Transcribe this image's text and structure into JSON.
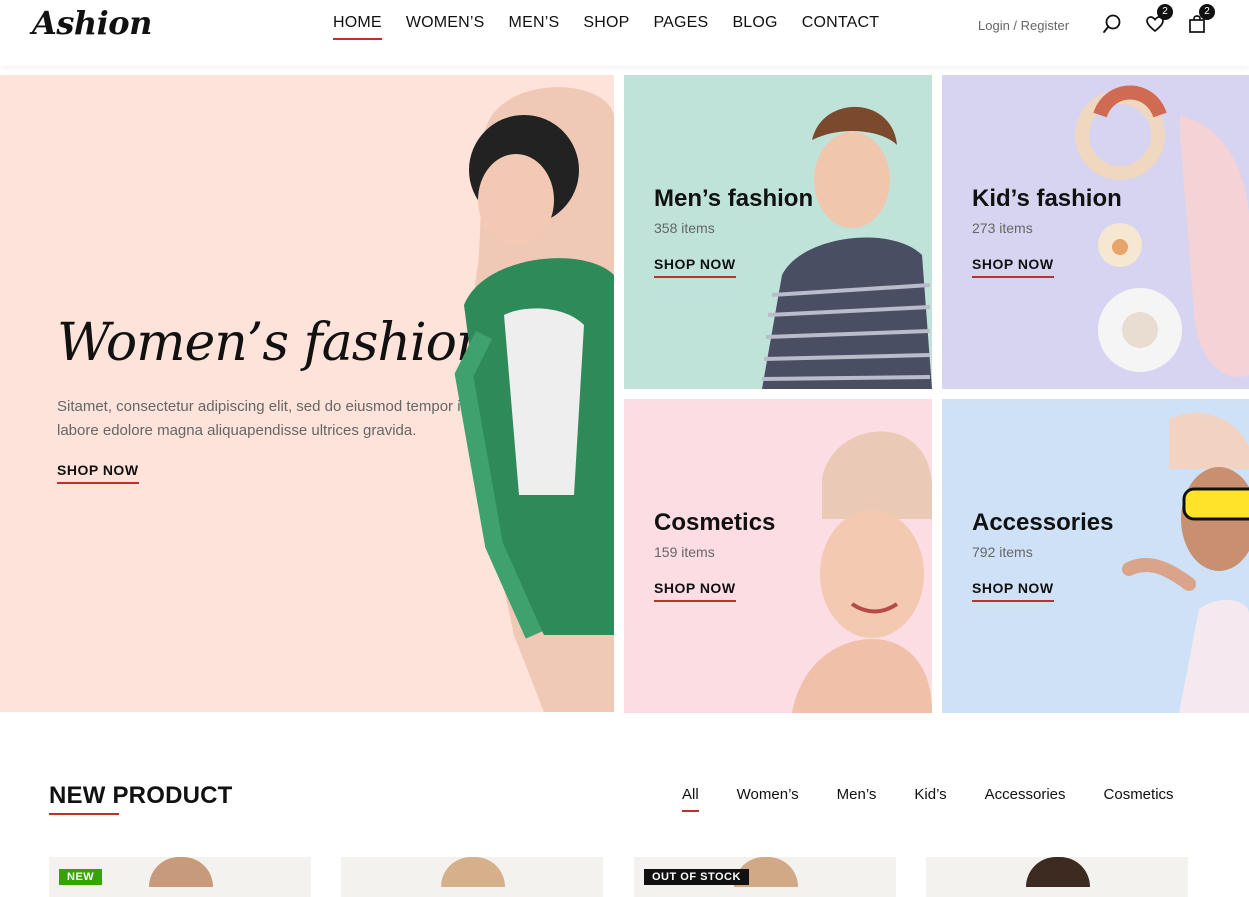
{
  "header": {
    "logo": "Ashion",
    "nav": [
      {
        "label": "HOME",
        "active": true
      },
      {
        "label": "WOMEN’S"
      },
      {
        "label": "MEN’S"
      },
      {
        "label": "SHOP"
      },
      {
        "label": "PAGES"
      },
      {
        "label": "BLOG"
      },
      {
        "label": "CONTACT"
      }
    ],
    "account": "Login / Register",
    "wishlist_count": "2",
    "cart_count": "2"
  },
  "hero": {
    "title": "Women’s fashion",
    "text": "Sitamet, consectetur adipiscing elit, sed do eiusmod tempor incidid-unt labore edolore magna aliquapendisse ultrices gravida.",
    "shop_label": "SHOP NOW",
    "bg": "#fde3d9"
  },
  "categories": [
    {
      "title": "Men’s fashion",
      "count": "358 items",
      "shop_label": "SHOP NOW",
      "bg": "#bfe3d9"
    },
    {
      "title": "Kid’s fashion",
      "count": "273 items",
      "shop_label": "SHOP NOW",
      "bg": "#d6d4f0"
    },
    {
      "title": "Cosmetics",
      "count": "159 items",
      "shop_label": "SHOP NOW",
      "bg": "#fbdde3"
    },
    {
      "title": "Accessories",
      "count": "792 items",
      "shop_label": "SHOP NOW",
      "bg": "#cfe1f6"
    }
  ],
  "new_product": {
    "title": "NEW PRODUCT",
    "filters": [
      {
        "label": "All",
        "active": true
      },
      {
        "label": "Women’s"
      },
      {
        "label": "Men’s"
      },
      {
        "label": "Kid’s"
      },
      {
        "label": "Accessories"
      },
      {
        "label": "Cosmetics"
      }
    ],
    "cards": [
      {
        "badge": "NEW",
        "badge_type": "new"
      },
      {
        "badge": ""
      },
      {
        "badge": "OUT OF STOCK",
        "badge_type": "oos"
      },
      {
        "badge": ""
      }
    ]
  },
  "colors": {
    "accent": "#c0302a",
    "new_badge": "#36a300"
  }
}
